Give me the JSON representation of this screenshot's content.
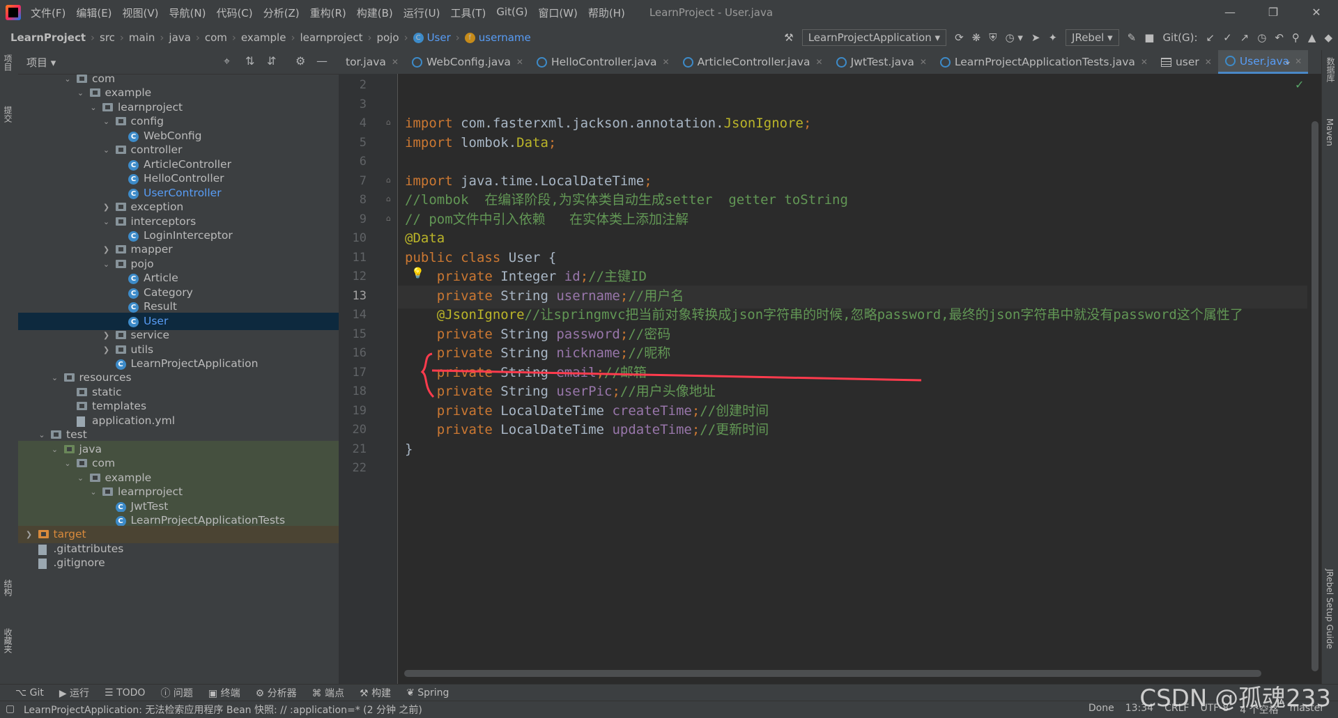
{
  "app": {
    "menu": [
      "文件(F)",
      "编辑(E)",
      "视图(V)",
      "导航(N)",
      "代码(C)",
      "分析(Z)",
      "重构(R)",
      "构建(B)",
      "运行(U)",
      "工具(T)",
      "Git(G)",
      "窗口(W)",
      "帮助(H)"
    ],
    "title": "LearnProject - User.java"
  },
  "breadcrumb": [
    "LearnProject",
    "src",
    "main",
    "java",
    "com",
    "example",
    "learnproject",
    "pojo",
    "User",
    "username"
  ],
  "toolbar": {
    "run_config": "LearnProjectApplication",
    "jrebel": "JRebel",
    "git_label": "Git(G):"
  },
  "project_panel": {
    "title": "项目",
    "tree": [
      {
        "label": "com",
        "indent": 4,
        "kind": "folder",
        "arrow": "down"
      },
      {
        "label": "example",
        "indent": 5,
        "kind": "folder",
        "arrow": "down"
      },
      {
        "label": "learnproject",
        "indent": 6,
        "kind": "folder",
        "arrow": "down"
      },
      {
        "label": "config",
        "indent": 7,
        "kind": "folder",
        "arrow": "down"
      },
      {
        "label": "WebConfig",
        "indent": 8,
        "kind": "class"
      },
      {
        "label": "controller",
        "indent": 7,
        "kind": "folder",
        "arrow": "down"
      },
      {
        "label": "ArticleController",
        "indent": 8,
        "kind": "class"
      },
      {
        "label": "HelloController",
        "indent": 8,
        "kind": "class"
      },
      {
        "label": "UserController",
        "indent": 8,
        "kind": "class",
        "blue": true
      },
      {
        "label": "exception",
        "indent": 7,
        "kind": "folder",
        "arrow": "right"
      },
      {
        "label": "interceptors",
        "indent": 7,
        "kind": "folder",
        "arrow": "down"
      },
      {
        "label": "LoginInterceptor",
        "indent": 8,
        "kind": "class"
      },
      {
        "label": "mapper",
        "indent": 7,
        "kind": "folder",
        "arrow": "right"
      },
      {
        "label": "pojo",
        "indent": 7,
        "kind": "folder",
        "arrow": "down"
      },
      {
        "label": "Article",
        "indent": 8,
        "kind": "class"
      },
      {
        "label": "Category",
        "indent": 8,
        "kind": "class"
      },
      {
        "label": "Result",
        "indent": 8,
        "kind": "class"
      },
      {
        "label": "User",
        "indent": 8,
        "kind": "class",
        "selected": true,
        "blue": true
      },
      {
        "label": "service",
        "indent": 7,
        "kind": "folder",
        "arrow": "right"
      },
      {
        "label": "utils",
        "indent": 7,
        "kind": "folder",
        "arrow": "right"
      },
      {
        "label": "LearnProjectApplication",
        "indent": 7,
        "kind": "class"
      },
      {
        "label": "resources",
        "indent": 3,
        "kind": "folder",
        "arrow": "down"
      },
      {
        "label": "static",
        "indent": 4,
        "kind": "folder"
      },
      {
        "label": "templates",
        "indent": 4,
        "kind": "folder"
      },
      {
        "label": "application.yml",
        "indent": 4,
        "kind": "file"
      },
      {
        "label": "test",
        "indent": 2,
        "kind": "folder",
        "arrow": "down"
      },
      {
        "label": "java",
        "indent": 3,
        "kind": "folder-green",
        "arrow": "down",
        "bg": "green"
      },
      {
        "label": "com",
        "indent": 4,
        "kind": "folder",
        "arrow": "down",
        "bg": "green"
      },
      {
        "label": "example",
        "indent": 5,
        "kind": "folder",
        "arrow": "down",
        "bg": "green"
      },
      {
        "label": "learnproject",
        "indent": 6,
        "kind": "folder",
        "arrow": "down",
        "bg": "green"
      },
      {
        "label": "JwtTest",
        "indent": 7,
        "kind": "class",
        "bg": "green"
      },
      {
        "label": "LearnProjectApplicationTests",
        "indent": 7,
        "kind": "class",
        "bg": "green"
      },
      {
        "label": "target",
        "indent": 1,
        "kind": "folder-orange",
        "arrow": "right",
        "bg": "orange",
        "orange": true
      },
      {
        "label": ".gitattributes",
        "indent": 1,
        "kind": "file"
      },
      {
        "label": ".gitignore",
        "indent": 1,
        "kind": "file"
      }
    ]
  },
  "tabs": [
    {
      "label": "tor.java",
      "icon": "none"
    },
    {
      "label": "WebConfig.java",
      "icon": "class"
    },
    {
      "label": "HelloController.java",
      "icon": "class"
    },
    {
      "label": "ArticleController.java",
      "icon": "class"
    },
    {
      "label": "JwtTest.java",
      "icon": "class"
    },
    {
      "label": "LearnProjectApplicationTests.java",
      "icon": "class"
    },
    {
      "label": "user",
      "icon": "table"
    },
    {
      "label": "User.java",
      "icon": "class",
      "active": true
    }
  ],
  "editor": {
    "current_line": 13,
    "lines": [
      {
        "n": 2,
        "tokens": []
      },
      {
        "n": 3,
        "tokens": []
      },
      {
        "n": 4,
        "tokens": [
          [
            "kw",
            "import "
          ],
          [
            "cls",
            "com.fasterxml.jackson.annotation."
          ],
          [
            "typ",
            "JsonIgnore"
          ],
          [
            "kw",
            ";"
          ]
        ]
      },
      {
        "n": 5,
        "tokens": [
          [
            "kw",
            "import "
          ],
          [
            "cls",
            "lombok."
          ],
          [
            "typ",
            "Data"
          ],
          [
            "kw",
            ";"
          ]
        ]
      },
      {
        "n": 6,
        "tokens": []
      },
      {
        "n": 7,
        "tokens": [
          [
            "kw",
            "import "
          ],
          [
            "cls",
            "java.time.LocalDateTime"
          ],
          [
            "kw",
            ";"
          ]
        ]
      },
      {
        "n": 8,
        "tokens": [
          [
            "cm",
            "//lombok  在编译阶段,为实体类自动生成setter  getter toString"
          ]
        ]
      },
      {
        "n": 9,
        "tokens": [
          [
            "cm",
            "// pom文件中引入依赖   在实体类上添加注解"
          ]
        ]
      },
      {
        "n": 10,
        "tokens": [
          [
            "an",
            "@Data"
          ]
        ]
      },
      {
        "n": 11,
        "tokens": [
          [
            "kw",
            "public class "
          ],
          [
            "cls",
            "User {"
          ]
        ]
      },
      {
        "n": 12,
        "tokens": [
          [
            "kw",
            "    private "
          ],
          [
            "cls",
            "Integer "
          ],
          [
            "fd",
            "id"
          ],
          [
            "kw",
            ";"
          ],
          [
            "cm",
            "//主键ID"
          ]
        ]
      },
      {
        "n": 13,
        "tokens": [
          [
            "kw",
            "    private "
          ],
          [
            "cls",
            "String "
          ],
          [
            "fd",
            "username"
          ],
          [
            "kw",
            ";"
          ],
          [
            "cm",
            "//用户名"
          ]
        ]
      },
      {
        "n": 14,
        "tokens": [
          [
            "an",
            "    @JsonIgnore"
          ],
          [
            "cm",
            "//让springmvc把当前对象转换成json字符串的时候,忽略password,最终的json字符串中就没有password这个属性了"
          ]
        ]
      },
      {
        "n": 15,
        "tokens": [
          [
            "kw",
            "    private "
          ],
          [
            "cls",
            "String "
          ],
          [
            "fd",
            "password"
          ],
          [
            "kw",
            ";"
          ],
          [
            "cm",
            "//密码"
          ]
        ]
      },
      {
        "n": 16,
        "tokens": [
          [
            "kw",
            "    private "
          ],
          [
            "cls",
            "String "
          ],
          [
            "fd",
            "nickname"
          ],
          [
            "kw",
            ";"
          ],
          [
            "cm",
            "//昵称"
          ]
        ]
      },
      {
        "n": 17,
        "tokens": [
          [
            "kw",
            "    private "
          ],
          [
            "cls",
            "String "
          ],
          [
            "fd",
            "email"
          ],
          [
            "kw",
            ";"
          ],
          [
            "cm",
            "//邮箱"
          ]
        ]
      },
      {
        "n": 18,
        "tokens": [
          [
            "kw",
            "    private "
          ],
          [
            "cls",
            "String "
          ],
          [
            "fd",
            "userPic"
          ],
          [
            "kw",
            ";"
          ],
          [
            "cm",
            "//用户头像地址"
          ]
        ]
      },
      {
        "n": 19,
        "tokens": [
          [
            "kw",
            "    private "
          ],
          [
            "cls",
            "LocalDateTime "
          ],
          [
            "fd",
            "createTime"
          ],
          [
            "kw",
            ";"
          ],
          [
            "cm",
            "//创建时间"
          ]
        ]
      },
      {
        "n": 20,
        "tokens": [
          [
            "kw",
            "    private "
          ],
          [
            "cls",
            "LocalDateTime "
          ],
          [
            "fd",
            "updateTime"
          ],
          [
            "kw",
            ";"
          ],
          [
            "cm",
            "//更新时间"
          ]
        ]
      },
      {
        "n": 21,
        "tokens": [
          [
            "cls",
            "}"
          ]
        ]
      },
      {
        "n": 22,
        "tokens": []
      }
    ]
  },
  "left_strip": [
    "项目",
    "提交",
    "结构",
    "收藏夹"
  ],
  "right_strip": [
    "数据库",
    "Maven",
    "JRebel Setup Guide"
  ],
  "bottom_tools": [
    "Git",
    "运行",
    "TODO",
    "问题",
    "终端",
    "分析器",
    "端点",
    "构建",
    "Spring"
  ],
  "status": {
    "message": "LearnProjectApplication: 无法检索应用程序 Bean 快照: // :application=* (2 分钟 之前)",
    "done": "Done",
    "position": "13:34",
    "line_sep": "CRLF",
    "encoding": "UTF-8",
    "indent": "4 个空格",
    "branch": "master"
  },
  "watermark": "CSDN @孤魂233"
}
